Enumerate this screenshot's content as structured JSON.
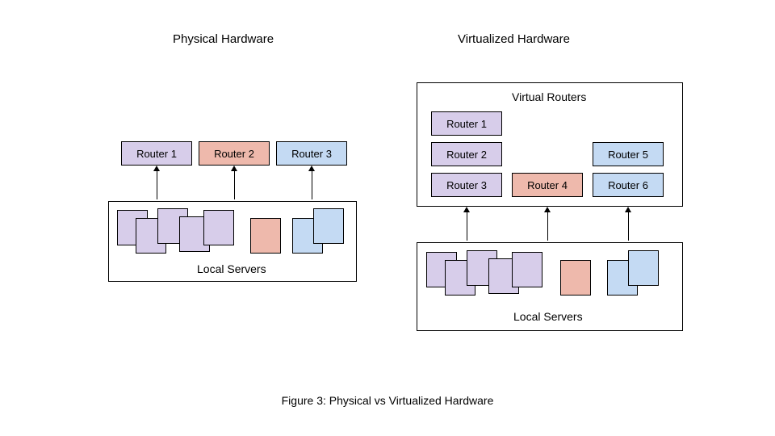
{
  "titles": {
    "physical": "Physical Hardware",
    "virtualized": "Virtualized Hardware"
  },
  "physical": {
    "routers": [
      "Router 1",
      "Router 2",
      "Router 3"
    ],
    "local_servers_label": "Local Servers"
  },
  "virtualized": {
    "virtual_routers_label": "Virtual Routers",
    "routers_left": [
      "Router 1",
      "Router 2",
      "Router 3"
    ],
    "router_4": "Router 4",
    "routers_right": [
      "Router 5",
      "Router 6"
    ],
    "local_servers_label": "Local Servers"
  },
  "caption": "Figure 3: Physical vs Virtualized Hardware",
  "colors": {
    "purple": "#d7cdea",
    "red": "#eeb9ac",
    "blue": "#c4daf3"
  }
}
